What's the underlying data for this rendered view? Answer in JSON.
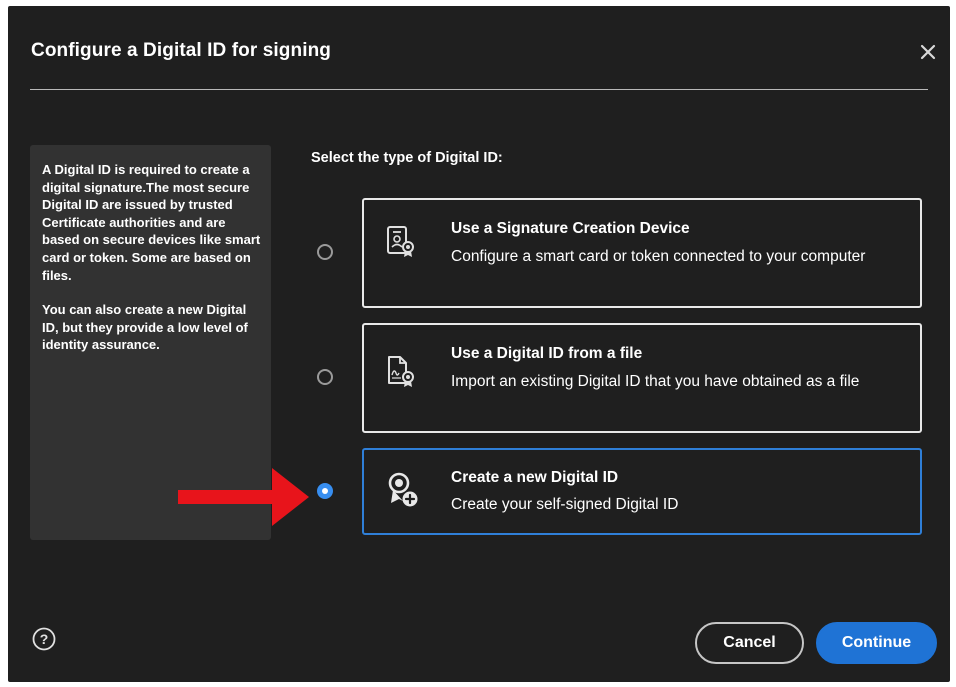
{
  "dialog": {
    "title": "Configure a Digital ID for signing",
    "close_icon": "close-icon"
  },
  "info_panel": {
    "paragraph_1": "A Digital ID is required to create a digital signature.The most secure Digital ID are issued by trusted Certificate authorities and are based on secure devices like smart card or token. Some are based on files.",
    "paragraph_2": "You can also create a new Digital ID, but they provide a low level of identity assurance."
  },
  "section_label": "Select the type of Digital ID:",
  "options": [
    {
      "title": "Use a Signature Creation Device",
      "description": "Configure a smart card or token connected to your computer",
      "icon": "signature-device-icon",
      "selected": false
    },
    {
      "title": "Use a Digital ID from a file",
      "description": "Import an existing Digital ID that you have obtained as a file",
      "icon": "digital-id-file-icon",
      "selected": false
    },
    {
      "title": "Create a new Digital ID",
      "description": "Create your self-signed Digital ID",
      "icon": "new-digital-id-icon",
      "selected": true
    }
  ],
  "annotation": {
    "icon": "red-arrow-icon",
    "color": "#e8141b"
  },
  "footer": {
    "help_icon": "help-icon",
    "cancel_label": "Cancel",
    "continue_label": "Continue"
  },
  "colors": {
    "background": "#1f1f1f",
    "panel": "#323232",
    "accent": "#378ef0",
    "primary_button": "#1f73d5"
  }
}
